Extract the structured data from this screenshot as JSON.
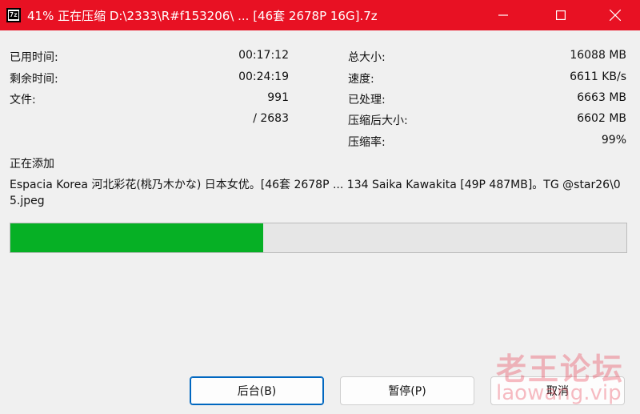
{
  "window": {
    "title": "41% 正在压缩 D:\\2333\\R#f153206\\ ... [46套 2678P 16G].7z",
    "icon_name": "7z-app-icon",
    "accent_color": "#e81123"
  },
  "stats_left": {
    "elapsed_label": "已用时间:",
    "elapsed_value": "00:17:12",
    "remaining_label": "剩余时间:",
    "remaining_value": "00:24:19",
    "files_label": "文件:",
    "files_value": "991",
    "files_total": "/ 2683"
  },
  "stats_right": {
    "total_size_label": "总大小:",
    "total_size_value": "16088 MB",
    "speed_label": "速度:",
    "speed_value": "6611 KB/s",
    "processed_label": "已处理:",
    "processed_value": "6663 MB",
    "compressed_label": "压缩后大小:",
    "compressed_value": "6602 MB",
    "ratio_label": "压缩率:",
    "ratio_value": "99%"
  },
  "current": {
    "status_label": "正在添加",
    "file_path": "Espacia Korea 河北彩花(桃乃木かな) 日本女优。[46套 2678P ... 134 Saika Kawakita [49P 487MB]。TG @star26\\05.jpeg"
  },
  "progress": {
    "fraction": 0.41,
    "fill_color": "#06b025"
  },
  "buttons": {
    "background_label": "后台(B)",
    "pause_label": "暂停(P)",
    "cancel_label": "取消"
  },
  "watermark": {
    "site_name": "老王论坛",
    "site_url": "laowang.vip"
  }
}
